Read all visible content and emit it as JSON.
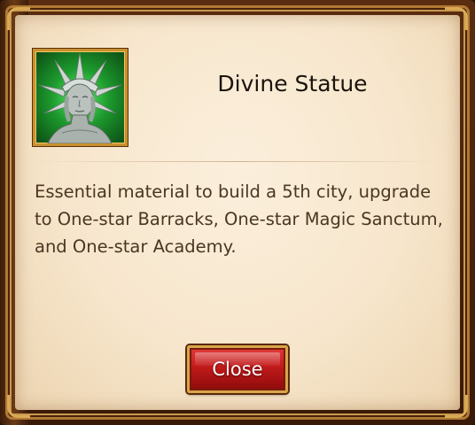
{
  "dialog": {
    "item_icon": "divine-statue-icon",
    "title": "Divine Statue",
    "description": "Essential material to build a 5th city, upgrade to One-star Barracks, One-star Magic Sanctum, and One-star Academy.",
    "close_label": "Close"
  },
  "colors": {
    "parchment": "#f7e6cc",
    "frame": "#5a2d10",
    "gold_trim": "#d8a54a",
    "close_button": "#c01a1a",
    "icon_glow": "#1d9a2d"
  }
}
